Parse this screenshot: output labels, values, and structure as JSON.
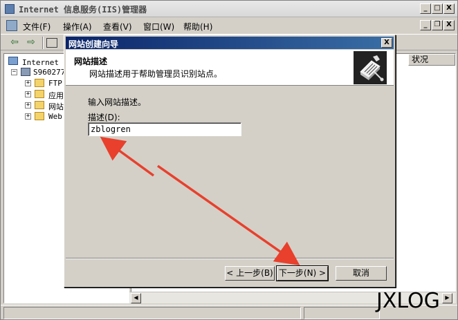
{
  "window": {
    "title": "Internet 信息服务(IIS)管理器",
    "minimize": "_",
    "maximize": "□",
    "close": "X"
  },
  "menu": {
    "items": [
      "文件(F)",
      "操作(A)",
      "查看(V)",
      "窗口(W)",
      "帮助(H)"
    ],
    "mdi_minimize": "_",
    "mdi_restore": "❐",
    "mdi_close": "X"
  },
  "toolbar": {
    "back": "⇦",
    "forward": "⇨"
  },
  "tree": {
    "root": "Internet 信",
    "server": "S960277",
    "children": [
      "FTP",
      "应用",
      "网站",
      "Web"
    ]
  },
  "right_pane": {
    "column_status": "状况"
  },
  "wizard": {
    "title": "网站创建向导",
    "close": "X",
    "header_title": "网站描述",
    "header_subtitle": "网站描述用于帮助管理员识别站点。",
    "prompt": "输入网站描述。",
    "field_label": "描述(D):",
    "field_value": "zblogren",
    "buttons": {
      "back": "< 上一步(B)",
      "next": "下一步(N) >",
      "cancel": "取消"
    }
  },
  "watermark": "JXLOG",
  "colors": {
    "annotation_red": "#e8402c",
    "title_gradient_start": "#0a246a",
    "title_gradient_end": "#3a6ea5"
  }
}
